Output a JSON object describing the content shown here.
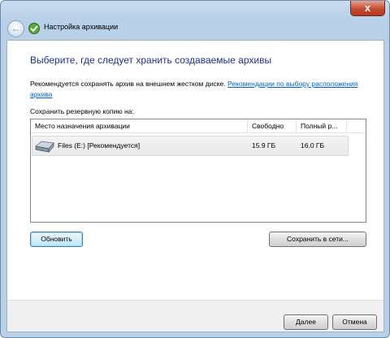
{
  "window": {
    "title": "Настройка архивации",
    "close_glyph": "x"
  },
  "page": {
    "heading": "Выберите, где следует хранить создаваемые архивы",
    "description": "Рекомендуется сохранять архив на внешнем жестком диске.",
    "description_link": "Рекомендации по выбору расположения архива",
    "save_to_label": "Сохранить резервную копию на:"
  },
  "list": {
    "columns": [
      "Место назначения архивации",
      "Свободно",
      "Полный р..."
    ],
    "rows": [
      {
        "name": "Files (E:) [Рекомендуется]",
        "free": "15.9 ГБ",
        "total": "16.0 ГБ",
        "icon": "hard-drive-icon"
      }
    ]
  },
  "buttons": {
    "refresh": "Обновить",
    "save_network": "Сохранить в сети...",
    "next": "Далее",
    "cancel": "Отмена"
  },
  "colors": {
    "heading": "#1e3287",
    "link": "#0066cc",
    "frame": "#b9d0e9",
    "close": "#c44a30"
  }
}
